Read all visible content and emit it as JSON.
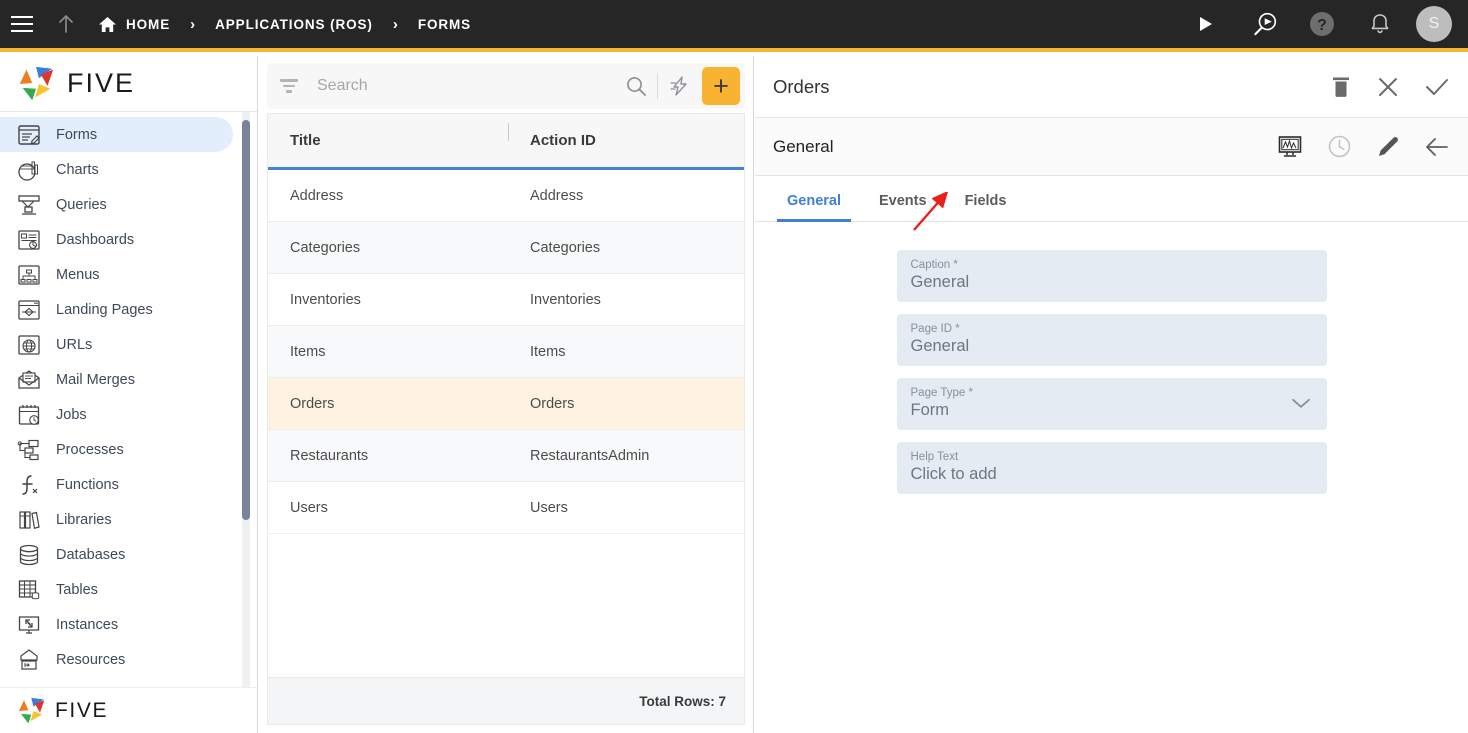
{
  "topbar": {
    "menu_icon": "hamburger-icon",
    "up_icon": "arrow-up-icon",
    "breadcrumbs": [
      {
        "label": "HOME",
        "icon": "home-icon"
      },
      {
        "label": "APPLICATIONS (ROS)",
        "icon": ""
      },
      {
        "label": "FORMS",
        "icon": ""
      }
    ],
    "separator": "›",
    "actions": [
      {
        "name": "run-icon",
        "label": ""
      },
      {
        "name": "search-preview-icon",
        "label": ""
      },
      {
        "name": "help-icon",
        "label": ""
      },
      {
        "name": "notifications-bell-icon",
        "label": ""
      }
    ],
    "avatar_initial": "S",
    "accent_bar_color": "#f5b731",
    "background_color": "#262626"
  },
  "sidebar": {
    "logo_text": "FIVE",
    "footer_logo_text": "FIVE",
    "items": [
      {
        "label": "Forms",
        "icon": "forms-icon",
        "active": true
      },
      {
        "label": "Charts",
        "icon": "charts-icon",
        "active": false
      },
      {
        "label": "Queries",
        "icon": "queries-icon",
        "active": false
      },
      {
        "label": "Dashboards",
        "icon": "dashboards-icon",
        "active": false
      },
      {
        "label": "Menus",
        "icon": "menus-icon",
        "active": false
      },
      {
        "label": "Landing Pages",
        "icon": "landing-pages-icon",
        "active": false
      },
      {
        "label": "URLs",
        "icon": "urls-icon",
        "active": false
      },
      {
        "label": "Mail Merges",
        "icon": "mail-merges-icon",
        "active": false
      },
      {
        "label": "Jobs",
        "icon": "jobs-icon",
        "active": false
      },
      {
        "label": "Processes",
        "icon": "processes-icon",
        "active": false
      },
      {
        "label": "Functions",
        "icon": "functions-icon",
        "active": false
      },
      {
        "label": "Libraries",
        "icon": "libraries-icon",
        "active": false
      },
      {
        "label": "Databases",
        "icon": "databases-icon",
        "active": false
      },
      {
        "label": "Tables",
        "icon": "tables-icon",
        "active": false
      },
      {
        "label": "Instances",
        "icon": "instances-icon",
        "active": false
      },
      {
        "label": "Resources",
        "icon": "resources-icon",
        "active": false
      }
    ],
    "active_background": "#e3eefc"
  },
  "list_pane": {
    "search": {
      "placeholder": "Search",
      "value": ""
    },
    "filter_icon": "filter-funnel-icon",
    "search_icon": "search-icon",
    "quick_action_icon": "lightning-bolt-icon",
    "add_button_label": "+",
    "add_button_color": "#f8b431",
    "columns": [
      "Title",
      "Action ID"
    ],
    "rows": [
      {
        "title": "Address",
        "action_id": "Address",
        "selected": false
      },
      {
        "title": "Categories",
        "action_id": "Categories",
        "selected": false
      },
      {
        "title": "Inventories",
        "action_id": "Inventories",
        "selected": false
      },
      {
        "title": "Items",
        "action_id": "Items",
        "selected": false
      },
      {
        "title": "Orders",
        "action_id": "Orders",
        "selected": true
      },
      {
        "title": "Restaurants",
        "action_id": "RestaurantsAdmin",
        "selected": false
      },
      {
        "title": "Users",
        "action_id": "Users",
        "selected": false
      }
    ],
    "footer_text": "Total Rows: 7",
    "selected_row_color": "#fdf3e0",
    "header_underline_color": "#4285d6"
  },
  "detail_pane": {
    "title": "Orders",
    "header_actions": [
      {
        "name": "delete-icon"
      },
      {
        "name": "close-icon"
      },
      {
        "name": "confirm-check-icon"
      }
    ],
    "subtitle": "General",
    "sub_actions": [
      {
        "name": "preview-display-icon"
      },
      {
        "name": "history-clock-icon"
      },
      {
        "name": "edit-pencil-icon"
      },
      {
        "name": "back-arrow-icon"
      }
    ],
    "tabs": [
      {
        "label": "General",
        "active": true
      },
      {
        "label": "Events",
        "active": false
      },
      {
        "label": "Fields",
        "active": false
      }
    ],
    "active_tab_color": "#3f7fd4",
    "fields": [
      {
        "label": "Caption *",
        "value": "General",
        "type": "text",
        "name": "caption-field"
      },
      {
        "label": "Page ID *",
        "value": "General",
        "type": "text",
        "name": "page-id-field"
      },
      {
        "label": "Page Type *",
        "value": "Form",
        "type": "select",
        "name": "page-type-select"
      },
      {
        "label": "Help Text",
        "value": "Click to add",
        "type": "text",
        "name": "help-text-field"
      }
    ]
  },
  "annotation": {
    "type": "arrow",
    "color": "#e8201a",
    "points_to": "Fields"
  }
}
